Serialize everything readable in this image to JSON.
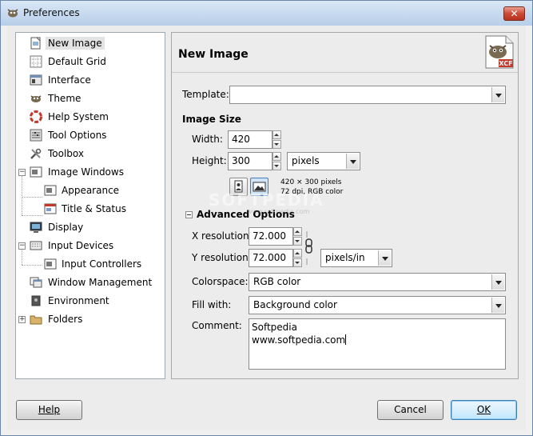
{
  "window": {
    "title": "Preferences",
    "close_glyph": "✕"
  },
  "sidebar": {
    "items": [
      {
        "label": "New Image",
        "icon": "new-image-icon"
      },
      {
        "label": "Default Grid",
        "icon": "grid-icon"
      },
      {
        "label": "Interface",
        "icon": "interface-icon"
      },
      {
        "label": "Theme",
        "icon": "theme-icon"
      },
      {
        "label": "Help System",
        "icon": "help-system-icon"
      },
      {
        "label": "Tool Options",
        "icon": "tool-options-icon"
      },
      {
        "label": "Toolbox",
        "icon": "toolbox-icon"
      },
      {
        "label": "Image Windows",
        "icon": "image-windows-icon"
      },
      {
        "label": "Appearance",
        "icon": "appearance-icon"
      },
      {
        "label": "Title & Status",
        "icon": "title-status-icon"
      },
      {
        "label": "Display",
        "icon": "display-icon"
      },
      {
        "label": "Input Devices",
        "icon": "input-devices-icon"
      },
      {
        "label": "Input Controllers",
        "icon": "input-controllers-icon"
      },
      {
        "label": "Window Management",
        "icon": "window-management-icon"
      },
      {
        "label": "Environment",
        "icon": "environment-icon"
      },
      {
        "label": "Folders",
        "icon": "folders-icon"
      }
    ],
    "selected": "New Image"
  },
  "panel": {
    "title": "New Image",
    "template_label": "Template:",
    "template_value": "",
    "image_size_heading": "Image Size",
    "width_label": "Width:",
    "width_value": "420",
    "height_label": "Height:",
    "height_value": "300",
    "size_unit": "pixels",
    "size_info_line1": "420 × 300 pixels",
    "size_info_line2": "72 dpi, RGB color",
    "advanced_heading": "Advanced Options",
    "xres_label": "X resolution:",
    "xres_value": "72.000",
    "yres_label": "Y resolution:",
    "yres_value": "72.000",
    "res_unit": "pixels/in",
    "colorspace_label": "Colorspace:",
    "colorspace_value": "RGB color",
    "fill_label": "Fill with:",
    "fill_value": "Background color",
    "comment_label": "Comment:",
    "comment_line1": "Softpedia",
    "comment_line2": "www.softpedia.com"
  },
  "buttons": {
    "help": "Help",
    "cancel": "Cancel",
    "ok": "OK"
  },
  "watermark": {
    "text": "SOFTPEDIA",
    "sub": "www.softpedia.com"
  }
}
